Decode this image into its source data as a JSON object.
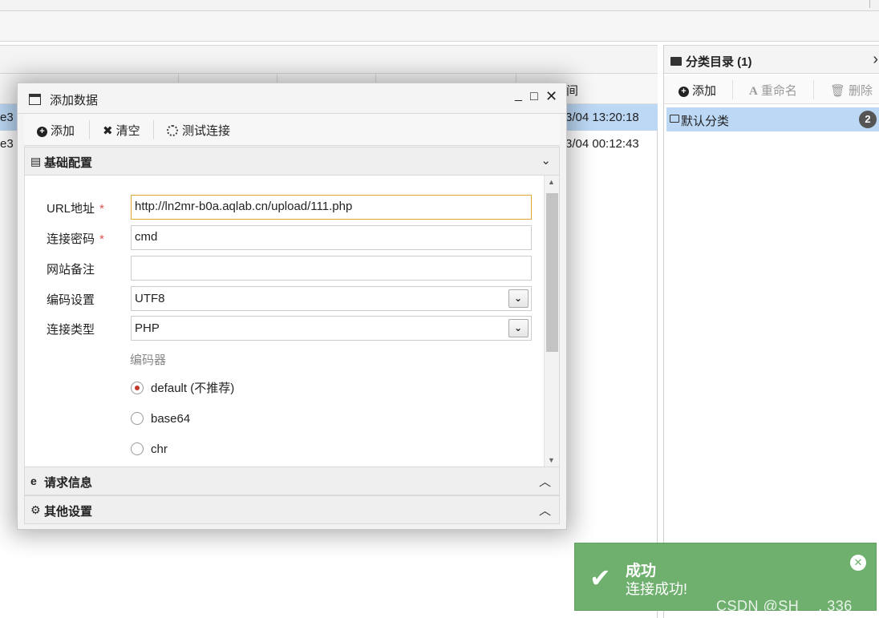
{
  "list": {
    "header_fragment": "间",
    "rows": [
      {
        "left": "e3",
        "right": "3/04 13:20:18",
        "selected": true
      },
      {
        "left": "e3",
        "right": "3/04 00:12:43",
        "selected": false
      }
    ]
  },
  "category": {
    "title": "分类目录 (1)",
    "add_label": "添加",
    "rename_label": "重命名",
    "delete_label": "删除",
    "item_label": "默认分类",
    "item_count": "2"
  },
  "dialog": {
    "title": "添加数据",
    "toolbar": {
      "add_label": "添加",
      "clear_label": "清空",
      "test_label": "测试连接"
    },
    "sections": {
      "basic": "基础配置",
      "request": "请求信息",
      "other": "其他设置"
    },
    "form": {
      "url_label": "URL地址",
      "url_value": "http://ln2mr-b0a.aqlab.cn/upload/111.php",
      "password_label": "连接密码",
      "password_value": "cmd",
      "note_label": "网站备注",
      "note_value": "",
      "encoding_label": "编码设置",
      "encoding_value": "UTF8",
      "type_label": "连接类型",
      "type_value": "PHP",
      "encoder_title": "编码器",
      "encoders": [
        "default (不推荐)",
        "base64",
        "chr"
      ],
      "selected_encoder": "default (不推荐)",
      "required_mark": "*"
    }
  },
  "toast": {
    "title": "成功",
    "message": "连接成功!",
    "color": "#6fb06f"
  },
  "watermark": "CSDN @SH　 . 336"
}
